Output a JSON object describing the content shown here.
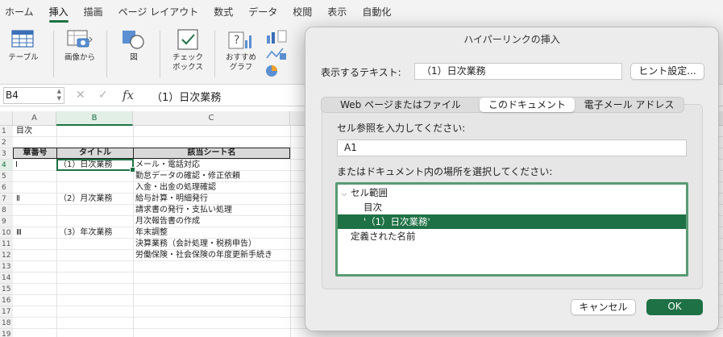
{
  "ribbon_tabs": [
    "ホーム",
    "挿入",
    "描画",
    "ページ レイアウト",
    "数式",
    "データ",
    "校閲",
    "表示",
    "自動化"
  ],
  "active_tab_index": 1,
  "ribbon_groups": {
    "table": "テーブル",
    "picture": "画像から",
    "shapes": "図",
    "checkbox_l1": "チェック",
    "checkbox_l2": "ボックス",
    "rec_chart_l1": "おすすめ",
    "rec_chart_l2": "グラフ"
  },
  "formula_bar": {
    "name_box": "B4",
    "cancel_icon": "✕",
    "enter_icon": "✓",
    "fx_label": "fx",
    "value": "（1）日次業務"
  },
  "columns": [
    "A",
    "B",
    "C"
  ],
  "rows": [
    "1",
    "2",
    "3",
    "4",
    "5",
    "6",
    "7",
    "8",
    "9",
    "10",
    "11",
    "12",
    "13",
    "14",
    "15",
    "16",
    "17",
    "18",
    "19"
  ],
  "sheet": {
    "a1": "目次",
    "header": {
      "a": "章番号",
      "b": "タイトル",
      "c": "該当シート名"
    },
    "r4": {
      "a": "Ⅰ",
      "b": "（1）日次業務",
      "c": "メール・電話対応"
    },
    "r5": {
      "c": "勤怠データの確認・修正依頼"
    },
    "r6": {
      "c": "入金・出金の処理確認"
    },
    "r7": {
      "a": "Ⅱ",
      "b": "（2）月次業務",
      "c": "給与計算・明細発行"
    },
    "r8": {
      "c": "請求書の発行・支払い処理"
    },
    "r9": {
      "c": "月次報告書の作成"
    },
    "r10": {
      "a": "Ⅲ",
      "b": "（3）年次業務",
      "c": "年末調整"
    },
    "r11": {
      "c": "決算業務（会計処理・税務申告）"
    },
    "r12": {
      "c": "労働保険・社会保険の年度更新手続き"
    }
  },
  "dialog": {
    "title": "ハイパーリンクの挿入",
    "display_text_label": "表示するテキスト:",
    "display_text_value": "（1）日次業務",
    "hint_button": "ヒント設定...",
    "tabs": [
      "Web ページまたはファイル",
      "このドキュメント",
      "電子メール アドレス"
    ],
    "active_tab_index": 1,
    "cell_ref_label": "セル参照を入力してください:",
    "cell_ref_value": "A1",
    "location_label": "またはドキュメント内の場所を選択してください:",
    "tree": {
      "group_cell_range": "セル範囲",
      "item_toc": "目次",
      "item_selected": "'（1）日次業務'",
      "group_defined_names": "定義された名前"
    },
    "cancel_button": "キャンセル",
    "ok_button": "OK"
  },
  "colors": {
    "accent": "#1e7145",
    "selection_fill": "#1e7145"
  }
}
